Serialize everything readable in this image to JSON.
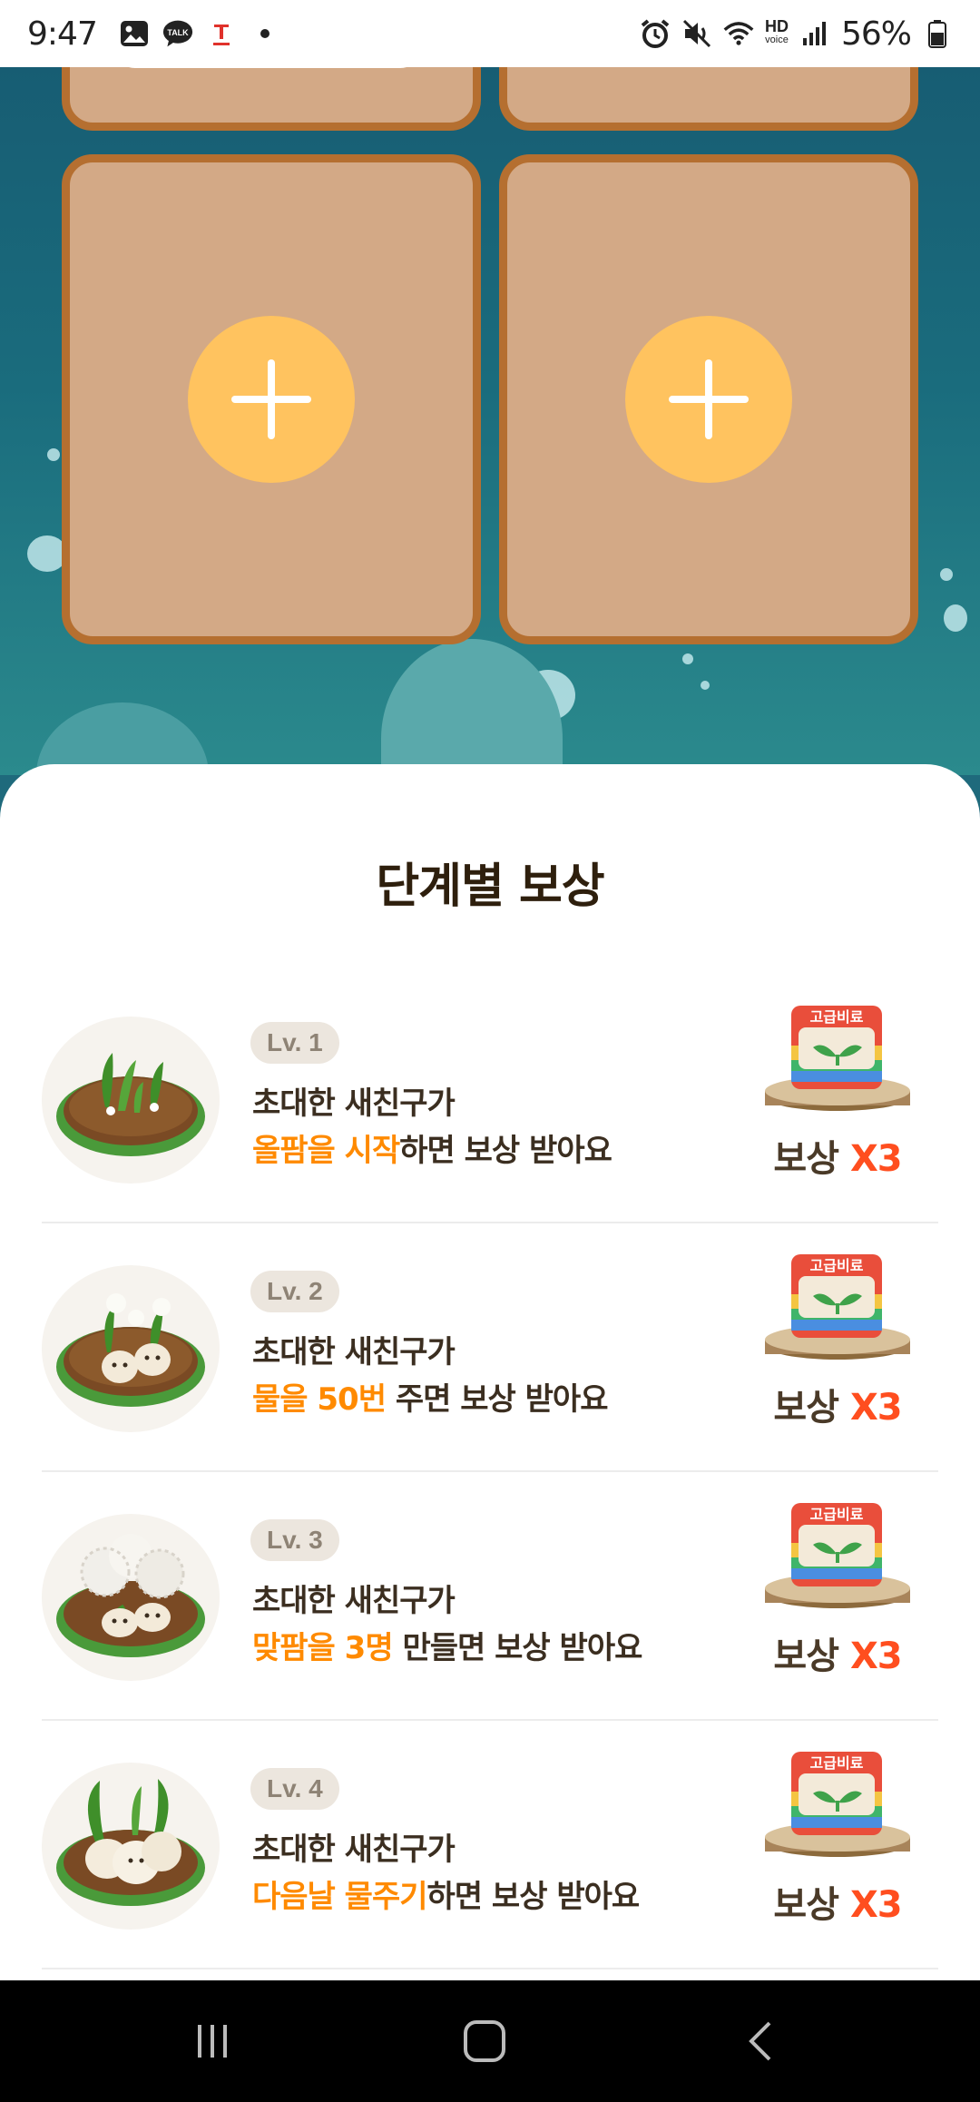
{
  "status_bar": {
    "time": "9:47",
    "battery": "56%",
    "hd_label": "HD",
    "hd_sub": "voice"
  },
  "sheet": {
    "title": "단계별 보상"
  },
  "rewards": [
    {
      "level": "Lv. 1",
      "line1": "초대한 새친구가",
      "accent": "올팜을 시작",
      "rest": "하면 보상 받아요",
      "reward_text": "보상",
      "reward_mult": "X3",
      "bag_label": "고급비료"
    },
    {
      "level": "Lv. 2",
      "line1": "초대한 새친구가",
      "accent": "물을 50번",
      "rest": " 주면 보상 받아요",
      "reward_text": "보상",
      "reward_mult": "X3",
      "bag_label": "고급비료"
    },
    {
      "level": "Lv. 3",
      "line1": "초대한 새친구가",
      "accent": "맞팜을 3명",
      "rest": " 만들면 보상 받아요",
      "reward_text": "보상",
      "reward_mult": "X3",
      "bag_label": "고급비료"
    },
    {
      "level": "Lv. 4",
      "line1": "초대한 새친구가",
      "accent": "다음날 물주기",
      "rest": "하면 보상 받아요",
      "reward_text": "보상",
      "reward_mult": "X3",
      "bag_label": "고급비료"
    }
  ],
  "colors": {
    "accent": "#ff8a00",
    "card_fill": "#d3a986",
    "card_border": "#b56f30",
    "plus_button": "#ffc35f",
    "multiplier": "#ff4e1f"
  }
}
